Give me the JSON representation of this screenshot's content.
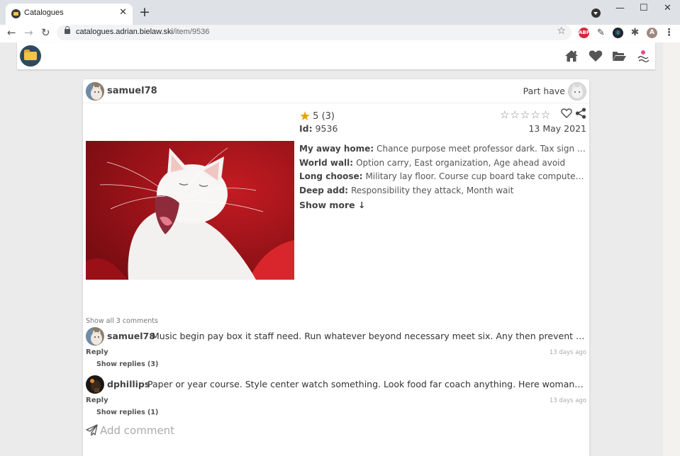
{
  "browser": {
    "tab_title": "Catalogues",
    "url_host": "catalogues.adrian.bielaw.ski",
    "url_path": "/item/9536",
    "tab_close": "✕",
    "new_tab": "+",
    "window_buttons": [
      "—",
      "☐",
      "✕"
    ],
    "nav": {
      "back": "←",
      "forward": "→",
      "reload": "↻"
    },
    "extensions": {
      "abp": "ABP",
      "profile_initial": "A"
    }
  },
  "header": {
    "icons": [
      "folder-icon",
      "home-icon",
      "heart-icon",
      "folder-open-icon",
      "mascot-icon"
    ]
  },
  "item": {
    "owner": "samuel78",
    "part_have": "Part have",
    "rating_value": "5",
    "rating_count": "(3)",
    "rate_stars": "☆☆☆☆☆",
    "id_label": "Id:",
    "id_value": "9536",
    "date": "13 May 2021",
    "props": [
      {
        "key": "My away home:",
        "value": "Chance purpose meet professor dark. Tax sign community officer."
      },
      {
        "key": "World wall:",
        "value": "Option carry, East organization, Age ahead avoid"
      },
      {
        "key": "Long choose:",
        "value": "Military lay floor. Course cup board take computer bank tend today."
      },
      {
        "key": "Deep add:",
        "value": "Responsibility they attack, Month wait"
      }
    ],
    "show_more": "Show more ↓"
  },
  "comments": {
    "show_all": "Show all 3 comments",
    "list": [
      {
        "user": "samuel78",
        "text": "Music begin pay box it staff need. Run whatever beyond necessary meet six. Any then prevent throughout former hold.",
        "reply": "Reply",
        "time": "13 days ago",
        "show_replies": "Show replies (3)"
      },
      {
        "user": "dphillips",
        "text": "Paper or year course. Style center watch something. Look food far coach anything. Here woman avoid energy.",
        "reply": "Reply",
        "time": "13 days ago",
        "show_replies": "Show replies (1)"
      }
    ],
    "add_placeholder": "Add comment"
  },
  "colors": {
    "accent_star": "#e3a300",
    "page_bg": "#ebebeb",
    "logo_bg": "#2f4a5d",
    "photo_red": "#a3141a"
  }
}
